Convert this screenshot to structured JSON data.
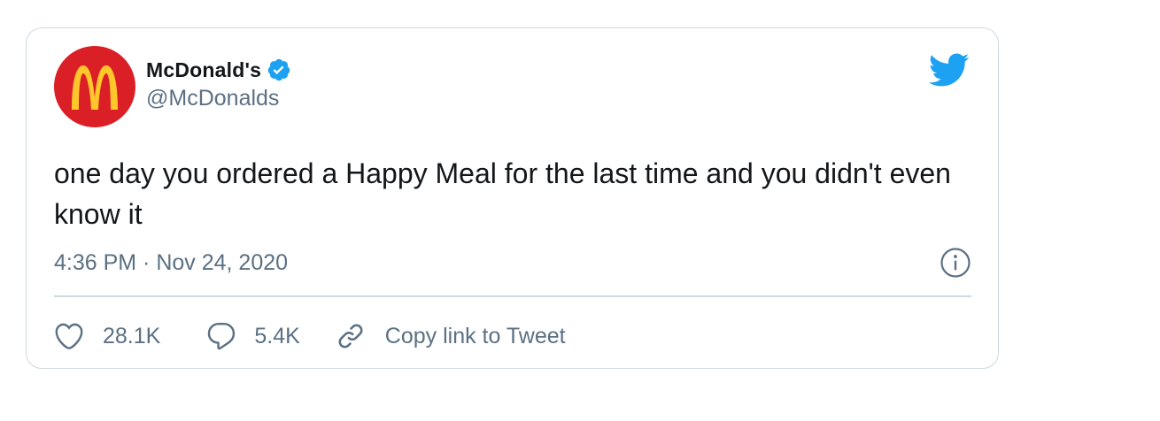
{
  "user": {
    "display_name": "McDonald's",
    "handle": "@McDonalds",
    "verified": true,
    "avatar": "mcdonalds-golden-arches-logo"
  },
  "tweet": {
    "text": "one day you ordered a Happy Meal for the last time and you didn't even know it",
    "timestamp": "4:36 PM · Nov 24, 2020"
  },
  "actions": {
    "likes": "28.1K",
    "replies": "5.4K",
    "copy_link": "Copy link to Tweet"
  },
  "icons": {
    "brand": "twitter-bird-icon",
    "info": "info-icon",
    "like": "heart-icon",
    "reply": "speech-bubble-icon",
    "link": "link-icon",
    "verified": "verified-badge-icon"
  },
  "colors": {
    "twitter_blue": "#1da1f2",
    "text_primary": "#14171a",
    "text_secondary": "#5b7083",
    "border": "#cfd9de",
    "mcd_red": "#db1f26",
    "mcd_yellow": "#ffc72c"
  }
}
